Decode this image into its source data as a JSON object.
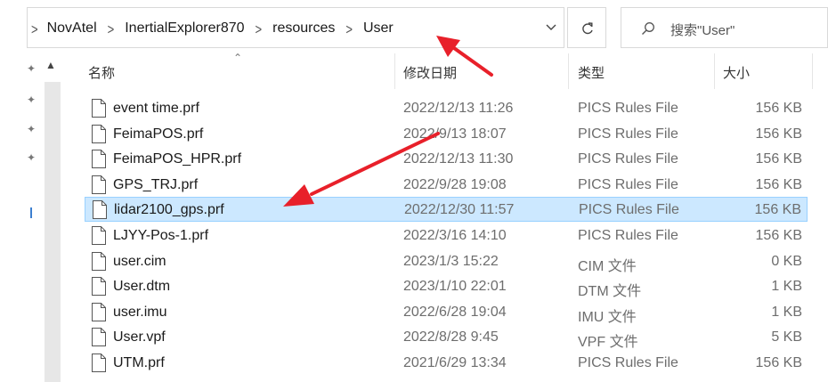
{
  "address": {
    "crumbs": [
      "NovAtel",
      "InertialExplorer870",
      "resources",
      "User"
    ]
  },
  "search": {
    "placeholder": "搜索\"User\""
  },
  "columns": {
    "name": "名称",
    "date": "修改日期",
    "type": "类型",
    "size": "大小"
  },
  "files": [
    {
      "name": "event time.prf",
      "date": "2022/12/13 11:26",
      "type": "PICS Rules File",
      "size": "156 KB"
    },
    {
      "name": "FeimaPOS.prf",
      "date": "2022/9/13 18:07",
      "type": "PICS Rules File",
      "size": "156 KB"
    },
    {
      "name": "FeimaPOS_HPR.prf",
      "date": "2022/12/13 11:30",
      "type": "PICS Rules File",
      "size": "156 KB"
    },
    {
      "name": "GPS_TRJ.prf",
      "date": "2022/9/28 19:08",
      "type": "PICS Rules File",
      "size": "156 KB"
    },
    {
      "name": "lidar2100_gps.prf",
      "date": "2022/12/30 11:57",
      "type": "PICS Rules File",
      "size": "156 KB"
    },
    {
      "name": "LJYY-Pos-1.prf",
      "date": "2022/3/16 14:10",
      "type": "PICS Rules File",
      "size": "156 KB"
    },
    {
      "name": "user.cim",
      "date": "2023/1/3 15:22",
      "type": "CIM 文件",
      "size": "0 KB"
    },
    {
      "name": "User.dtm",
      "date": "2023/1/10 22:01",
      "type": "DTM 文件",
      "size": "1 KB"
    },
    {
      "name": "user.imu",
      "date": "2022/6/28 19:04",
      "type": "IMU 文件",
      "size": "1 KB"
    },
    {
      "name": "User.vpf",
      "date": "2022/8/28 9:45",
      "type": "VPF 文件",
      "size": "5 KB"
    },
    {
      "name": "UTM.prf",
      "date": "2021/6/29 13:34",
      "type": "PICS Rules File",
      "size": "156 KB"
    }
  ],
  "selected_file": "lidar2100_gps.prf",
  "icons": {
    "dropdown": "chevron-down-icon",
    "refresh": "refresh-icon",
    "search": "search-icon",
    "file": "file-icon",
    "pin": "pin-icon"
  },
  "colors": {
    "selection_bg": "#cce8ff",
    "selection_border": "#99d1ff",
    "annotation": "#e8202a"
  }
}
